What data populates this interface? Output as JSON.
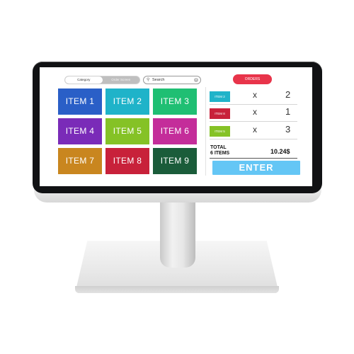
{
  "toolbar": {
    "category_label": "Category",
    "second_tab_label": "Order Screen",
    "search_label": "Search",
    "orders_label": "ORDERS"
  },
  "items": [
    {
      "label": "ITEM 1",
      "color": "#2a5fc7"
    },
    {
      "label": "ITEM 2",
      "color": "#1fb3c9"
    },
    {
      "label": "ITEM 3",
      "color": "#1fbf73"
    },
    {
      "label": "ITEM 4",
      "color": "#7a2bb8"
    },
    {
      "label": "ITEM 5",
      "color": "#85c226"
    },
    {
      "label": "ITEM 6",
      "color": "#c42d9a"
    },
    {
      "label": "ITEM 7",
      "color": "#c9861f"
    },
    {
      "label": "ITEM 8",
      "color": "#c8213a"
    },
    {
      "label": "ITEM 9",
      "color": "#1a5c3a"
    }
  ],
  "order": {
    "rows": [
      {
        "item": "ITEM 2",
        "x": "x",
        "qty": "2",
        "color": "#1fb3c9"
      },
      {
        "item": "ITEM 8",
        "x": "x",
        "qty": "1",
        "color": "#c8213a"
      },
      {
        "item": "ITEM 5",
        "x": "x",
        "qty": "3",
        "color": "#85c226"
      }
    ],
    "total_label": "TOTAL",
    "items_count": "6 ITEMS",
    "total_value": "10.24$",
    "enter_label": "ENTER"
  }
}
